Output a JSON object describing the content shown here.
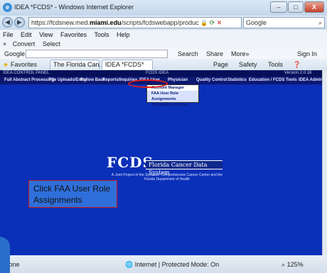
{
  "window": {
    "title": "IDEA *FCDS* - Windows Internet Explorer",
    "min": "–",
    "max": "□",
    "close": "X"
  },
  "address": {
    "url_prefix": "https://fcdsnew.med.",
    "url_bold": "miami.edu",
    "url_suffix": "/scripts/fcdswebapp/produc",
    "search_engine": "Google",
    "back": "◀",
    "forward": "▶"
  },
  "menu": [
    "File",
    "Edit",
    "View",
    "Favorites",
    "Tools",
    "Help"
  ],
  "convert": {
    "convert": "Convert",
    "select": "Select"
  },
  "google_bar": {
    "label": "Google",
    "search": "Search",
    "share": "Share",
    "more": "More»",
    "signin": "Sign In"
  },
  "favorites": {
    "label": "Favorites",
    "tabs": [
      "The Florida Can...",
      "IDEA *FCDS*"
    ],
    "page": "Page",
    "safety": "Safety",
    "tools": "Tools"
  },
  "page": {
    "header_left": "IDEA CONTROL PANEL",
    "header_center": "FCDS IDEA",
    "header_right": "Version 2.0.16",
    "nav": [
      "Full Abstract Processing",
      "File Uploads/Entry",
      "Follow Back",
      "Reports/Inquiries",
      "IDEA User",
      "Physician",
      "Quality Control",
      "Statistics",
      "Education / FCDS Tools",
      "IDEA Admin"
    ],
    "dropdown": [
      "Account Manager",
      "FAA User Role Assignments",
      "Add additional Role"
    ],
    "callout": "Click FAA User Role Assignments",
    "logo_letters": "FCDS",
    "logo_name": "Florida Cancer Data System",
    "logo_sub": "A Joint Project of the Sylvester Comprehensive Cancer Center and the Florida Department of Health"
  },
  "status": {
    "left": "Done",
    "mid": "Internet | Protected Mode: On",
    "zoom": "125%"
  }
}
